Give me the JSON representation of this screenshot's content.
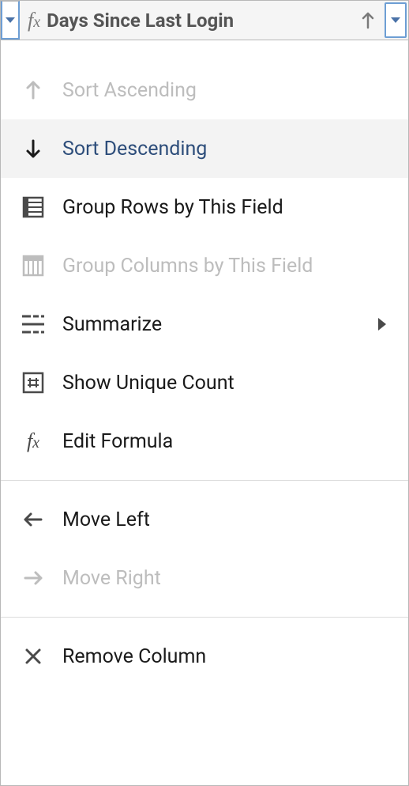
{
  "header": {
    "column_title": "Days Since Last Login",
    "fx_label": "fx"
  },
  "menu": {
    "sort_ascending": "Sort Ascending",
    "sort_descending": "Sort Descending",
    "group_rows": "Group Rows by This Field",
    "group_columns": "Group Columns by This Field",
    "summarize": "Summarize",
    "show_unique_count": "Show Unique Count",
    "edit_formula": "Edit Formula",
    "move_left": "Move Left",
    "move_right": "Move Right",
    "remove_column": "Remove Column"
  }
}
